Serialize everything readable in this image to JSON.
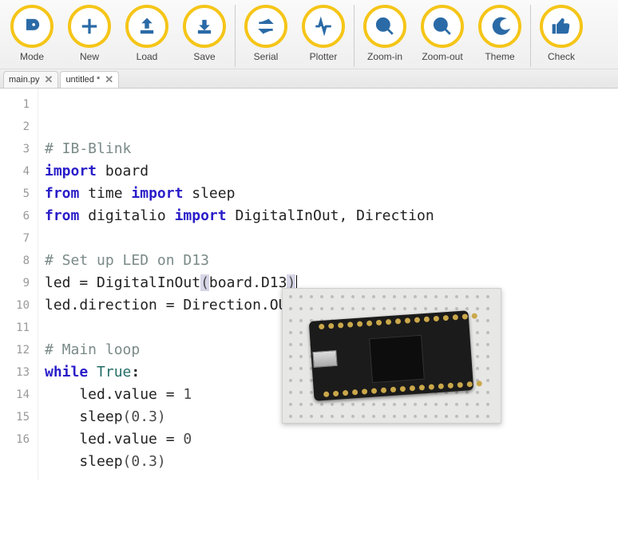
{
  "toolbar": [
    {
      "name": "mode-button",
      "label": "Mode",
      "icon": "mode-icon"
    },
    {
      "name": "new-button",
      "label": "New",
      "icon": "plus-icon"
    },
    {
      "name": "load-button",
      "label": "Load",
      "icon": "upload-icon"
    },
    {
      "name": "save-button",
      "label": "Save",
      "icon": "download-icon"
    },
    {
      "sep": true
    },
    {
      "name": "serial-button",
      "label": "Serial",
      "icon": "arrows-icon"
    },
    {
      "name": "plotter-button",
      "label": "Plotter",
      "icon": "pulse-icon"
    },
    {
      "sep": true
    },
    {
      "name": "zoom-in-button",
      "label": "Zoom-in",
      "icon": "zoom-in-icon"
    },
    {
      "name": "zoom-out-button",
      "label": "Zoom-out",
      "icon": "zoom-out-icon"
    },
    {
      "name": "theme-button",
      "label": "Theme",
      "icon": "moon-icon"
    },
    {
      "sep": true
    },
    {
      "name": "check-button",
      "label": "Check",
      "icon": "thumb-icon"
    }
  ],
  "tabs": [
    {
      "name": "tab-main",
      "label": "main.py",
      "active": false
    },
    {
      "name": "tab-untitled",
      "label": "untitled *",
      "active": true
    }
  ],
  "code": {
    "lines": [
      {
        "n": 1,
        "tokens": [
          {
            "t": "# IB-Blink",
            "c": "comment"
          }
        ]
      },
      {
        "n": 2,
        "tokens": [
          {
            "t": "import",
            "c": "kw"
          },
          {
            "t": " board",
            "c": "name"
          }
        ]
      },
      {
        "n": 3,
        "tokens": [
          {
            "t": "from",
            "c": "kw"
          },
          {
            "t": " time ",
            "c": "name"
          },
          {
            "t": "import",
            "c": "kw"
          },
          {
            "t": " sleep",
            "c": "name"
          }
        ]
      },
      {
        "n": 4,
        "tokens": [
          {
            "t": "from",
            "c": "kw"
          },
          {
            "t": " digitalio ",
            "c": "name"
          },
          {
            "t": "import",
            "c": "kw"
          },
          {
            "t": " DigitalInOut, Direction",
            "c": "name"
          }
        ]
      },
      {
        "n": 5,
        "tokens": []
      },
      {
        "n": 6,
        "tokens": [
          {
            "t": "# Set up LED on D13",
            "c": "comment"
          }
        ]
      },
      {
        "n": 7,
        "tokens": [
          {
            "t": "led = DigitalInOut",
            "c": "name"
          },
          {
            "t": "(",
            "c": "paren hl-paren"
          },
          {
            "t": "board.D13",
            "c": "name"
          },
          {
            "t": ")",
            "c": "paren hl-paren"
          }
        ],
        "cursor": true
      },
      {
        "n": 8,
        "tokens": [
          {
            "t": "led.direction = Direction.OUTPUT",
            "c": "name"
          }
        ]
      },
      {
        "n": 9,
        "tokens": []
      },
      {
        "n": 10,
        "tokens": [
          {
            "t": "# Main loop",
            "c": "comment"
          }
        ]
      },
      {
        "n": 11,
        "tokens": [
          {
            "t": "while",
            "c": "kw"
          },
          {
            "t": " ",
            "c": "name"
          },
          {
            "t": "True",
            "c": "builtin"
          },
          {
            "t": ":",
            "c": "colon"
          }
        ]
      },
      {
        "n": 12,
        "tokens": [
          {
            "t": "    led.value = ",
            "c": "name"
          },
          {
            "t": "1",
            "c": "num"
          }
        ]
      },
      {
        "n": 13,
        "tokens": [
          {
            "t": "    sleep",
            "c": "name"
          },
          {
            "t": "(",
            "c": "paren"
          },
          {
            "t": "0.3",
            "c": "num"
          },
          {
            "t": ")",
            "c": "paren"
          }
        ]
      },
      {
        "n": 14,
        "tokens": [
          {
            "t": "    led.value = ",
            "c": "name"
          },
          {
            "t": "0",
            "c": "num"
          }
        ]
      },
      {
        "n": 15,
        "tokens": [
          {
            "t": "    sleep",
            "c": "name"
          },
          {
            "t": "(",
            "c": "paren"
          },
          {
            "t": "0.3",
            "c": "num"
          },
          {
            "t": ")",
            "c": "paren"
          }
        ]
      },
      {
        "n": 16,
        "tokens": []
      }
    ]
  },
  "board_image": {
    "alt": "Adafruit ItsyBitsy microcontroller on breadboard"
  }
}
